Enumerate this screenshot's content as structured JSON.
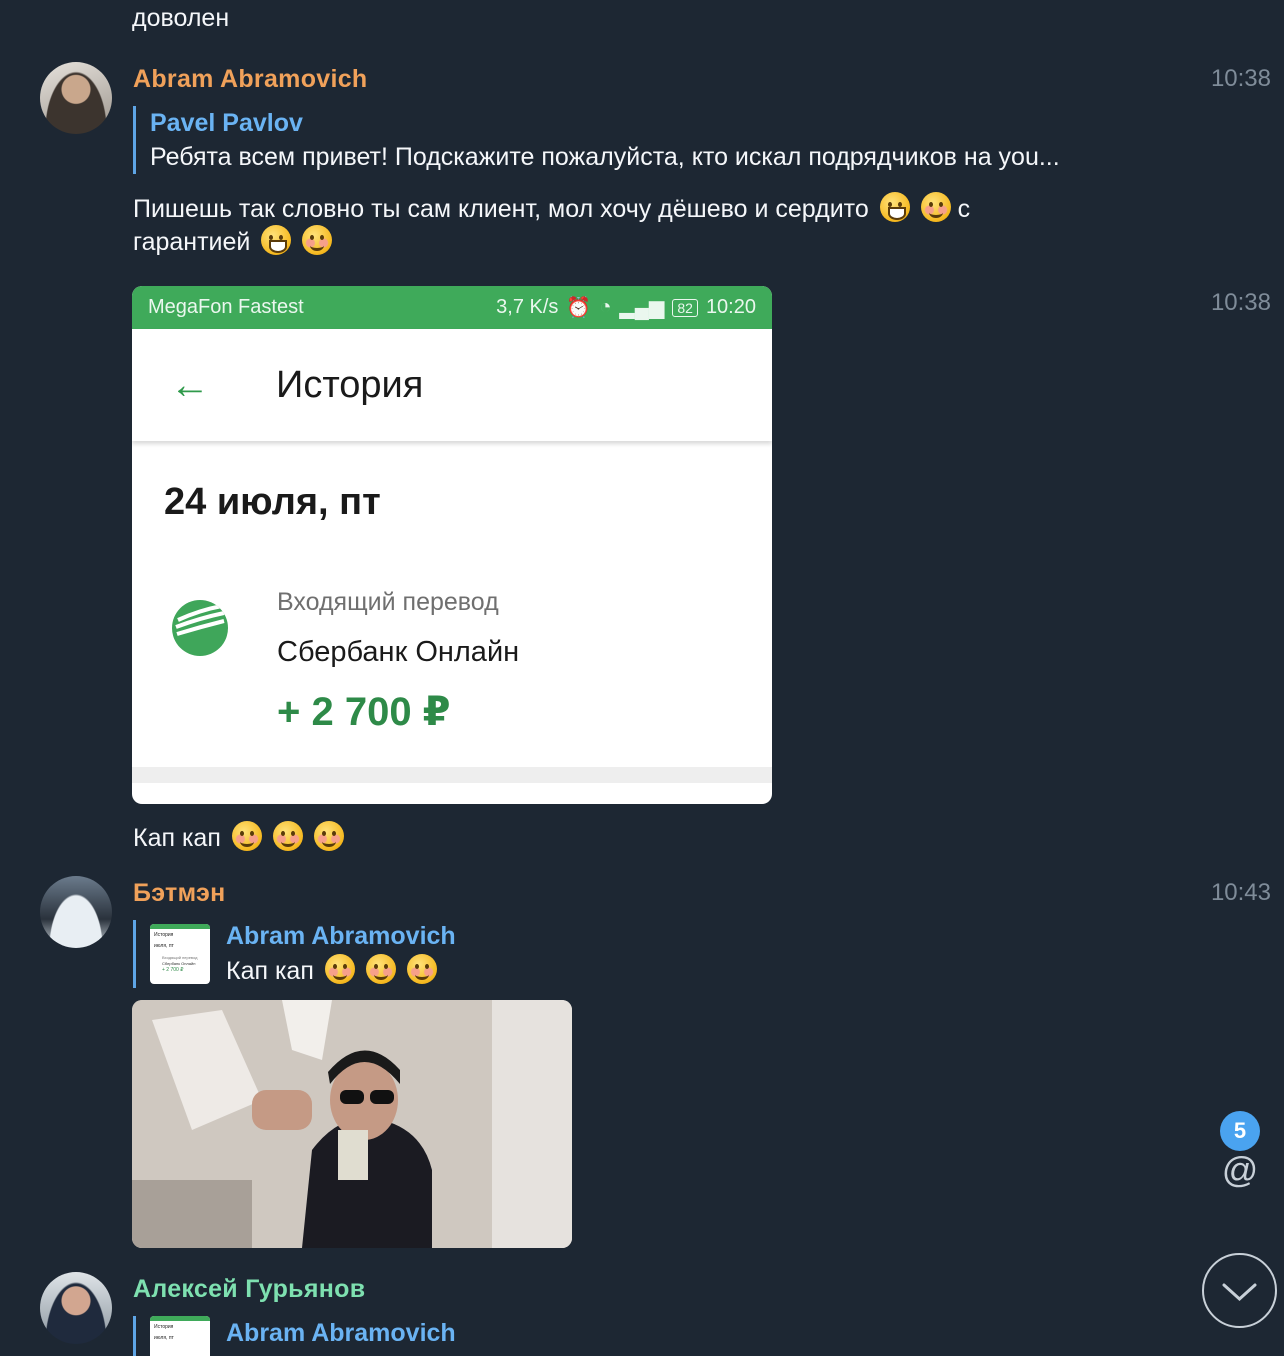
{
  "top_text": "доволен",
  "msg1": {
    "author": "Abram Abramovich",
    "time": "10:38",
    "reply_author": "Pavel Pavlov",
    "reply_text": "Ребята всем привет! Подскажите пожалуйста, кто искал подрядчиков на you...",
    "text_line1": "Пишешь так словно ты сам клиент, мол хочу дёшево и сердито",
    "text_line1_tail": "с",
    "text_line2": "гарантией",
    "name_color": "#f0a15a"
  },
  "msg2": {
    "time": "10:38",
    "screenshot": {
      "carrier": "MegaFon Fastest",
      "speed": "3,7 K/s",
      "battery": "82",
      "clock": "10:20",
      "title": "История",
      "date": "24 июля, пт",
      "txn_type": "Входящий перевод",
      "txn_source": "Сбербанк Онлайн",
      "txn_amount": "+ 2 700 ₽"
    },
    "caption": "Кап кап"
  },
  "msg3": {
    "author": "Бэтмэн",
    "time": "10:43",
    "reply_author": "Abram Abramovich",
    "reply_text": "Кап кап",
    "name_color": "#f0a15a",
    "thumb_title": "История",
    "thumb_date": "июля, пт",
    "thumb_type": "Входящий перевод",
    "thumb_src": "Сбербанк Онлайн",
    "thumb_amt": "+ 2 700 ₽"
  },
  "msg4": {
    "author": "Алексей Гурьянов",
    "reply_author": "Abram Abramovich",
    "name_color": "#7ee0b0",
    "thumb_title": "История",
    "thumb_date": "июля, пт"
  },
  "unread_count": "5",
  "mention_symbol": "@"
}
